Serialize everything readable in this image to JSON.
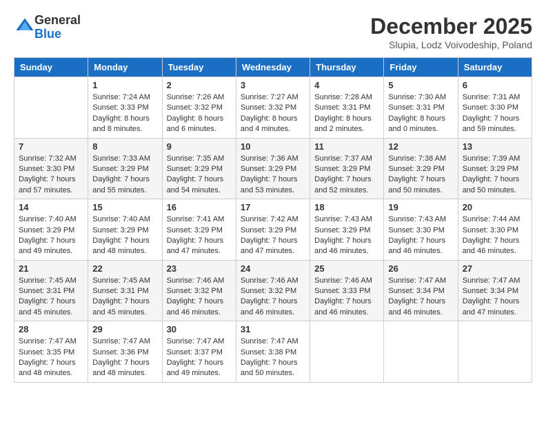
{
  "header": {
    "logo_general": "General",
    "logo_blue": "Blue",
    "month_title": "December 2025",
    "location": "Slupia, Lodz Voivodeship, Poland"
  },
  "weekdays": [
    "Sunday",
    "Monday",
    "Tuesday",
    "Wednesday",
    "Thursday",
    "Friday",
    "Saturday"
  ],
  "weeks": [
    [
      {
        "day": "",
        "sunrise": "",
        "sunset": "",
        "daylight": ""
      },
      {
        "day": "1",
        "sunrise": "Sunrise: 7:24 AM",
        "sunset": "Sunset: 3:33 PM",
        "daylight": "Daylight: 8 hours and 8 minutes."
      },
      {
        "day": "2",
        "sunrise": "Sunrise: 7:26 AM",
        "sunset": "Sunset: 3:32 PM",
        "daylight": "Daylight: 8 hours and 6 minutes."
      },
      {
        "day": "3",
        "sunrise": "Sunrise: 7:27 AM",
        "sunset": "Sunset: 3:32 PM",
        "daylight": "Daylight: 8 hours and 4 minutes."
      },
      {
        "day": "4",
        "sunrise": "Sunrise: 7:28 AM",
        "sunset": "Sunset: 3:31 PM",
        "daylight": "Daylight: 8 hours and 2 minutes."
      },
      {
        "day": "5",
        "sunrise": "Sunrise: 7:30 AM",
        "sunset": "Sunset: 3:31 PM",
        "daylight": "Daylight: 8 hours and 0 minutes."
      },
      {
        "day": "6",
        "sunrise": "Sunrise: 7:31 AM",
        "sunset": "Sunset: 3:30 PM",
        "daylight": "Daylight: 7 hours and 59 minutes."
      }
    ],
    [
      {
        "day": "7",
        "sunrise": "Sunrise: 7:32 AM",
        "sunset": "Sunset: 3:30 PM",
        "daylight": "Daylight: 7 hours and 57 minutes."
      },
      {
        "day": "8",
        "sunrise": "Sunrise: 7:33 AM",
        "sunset": "Sunset: 3:29 PM",
        "daylight": "Daylight: 7 hours and 55 minutes."
      },
      {
        "day": "9",
        "sunrise": "Sunrise: 7:35 AM",
        "sunset": "Sunset: 3:29 PM",
        "daylight": "Daylight: 7 hours and 54 minutes."
      },
      {
        "day": "10",
        "sunrise": "Sunrise: 7:36 AM",
        "sunset": "Sunset: 3:29 PM",
        "daylight": "Daylight: 7 hours and 53 minutes."
      },
      {
        "day": "11",
        "sunrise": "Sunrise: 7:37 AM",
        "sunset": "Sunset: 3:29 PM",
        "daylight": "Daylight: 7 hours and 52 minutes."
      },
      {
        "day": "12",
        "sunrise": "Sunrise: 7:38 AM",
        "sunset": "Sunset: 3:29 PM",
        "daylight": "Daylight: 7 hours and 50 minutes."
      },
      {
        "day": "13",
        "sunrise": "Sunrise: 7:39 AM",
        "sunset": "Sunset: 3:29 PM",
        "daylight": "Daylight: 7 hours and 50 minutes."
      }
    ],
    [
      {
        "day": "14",
        "sunrise": "Sunrise: 7:40 AM",
        "sunset": "Sunset: 3:29 PM",
        "daylight": "Daylight: 7 hours and 49 minutes."
      },
      {
        "day": "15",
        "sunrise": "Sunrise: 7:40 AM",
        "sunset": "Sunset: 3:29 PM",
        "daylight": "Daylight: 7 hours and 48 minutes."
      },
      {
        "day": "16",
        "sunrise": "Sunrise: 7:41 AM",
        "sunset": "Sunset: 3:29 PM",
        "daylight": "Daylight: 7 hours and 47 minutes."
      },
      {
        "day": "17",
        "sunrise": "Sunrise: 7:42 AM",
        "sunset": "Sunset: 3:29 PM",
        "daylight": "Daylight: 7 hours and 47 minutes."
      },
      {
        "day": "18",
        "sunrise": "Sunrise: 7:43 AM",
        "sunset": "Sunset: 3:29 PM",
        "daylight": "Daylight: 7 hours and 46 minutes."
      },
      {
        "day": "19",
        "sunrise": "Sunrise: 7:43 AM",
        "sunset": "Sunset: 3:30 PM",
        "daylight": "Daylight: 7 hours and 46 minutes."
      },
      {
        "day": "20",
        "sunrise": "Sunrise: 7:44 AM",
        "sunset": "Sunset: 3:30 PM",
        "daylight": "Daylight: 7 hours and 46 minutes."
      }
    ],
    [
      {
        "day": "21",
        "sunrise": "Sunrise: 7:45 AM",
        "sunset": "Sunset: 3:31 PM",
        "daylight": "Daylight: 7 hours and 45 minutes."
      },
      {
        "day": "22",
        "sunrise": "Sunrise: 7:45 AM",
        "sunset": "Sunset: 3:31 PM",
        "daylight": "Daylight: 7 hours and 45 minutes."
      },
      {
        "day": "23",
        "sunrise": "Sunrise: 7:46 AM",
        "sunset": "Sunset: 3:32 PM",
        "daylight": "Daylight: 7 hours and 46 minutes."
      },
      {
        "day": "24",
        "sunrise": "Sunrise: 7:46 AM",
        "sunset": "Sunset: 3:32 PM",
        "daylight": "Daylight: 7 hours and 46 minutes."
      },
      {
        "day": "25",
        "sunrise": "Sunrise: 7:46 AM",
        "sunset": "Sunset: 3:33 PM",
        "daylight": "Daylight: 7 hours and 46 minutes."
      },
      {
        "day": "26",
        "sunrise": "Sunrise: 7:47 AM",
        "sunset": "Sunset: 3:34 PM",
        "daylight": "Daylight: 7 hours and 46 minutes."
      },
      {
        "day": "27",
        "sunrise": "Sunrise: 7:47 AM",
        "sunset": "Sunset: 3:34 PM",
        "daylight": "Daylight: 7 hours and 47 minutes."
      }
    ],
    [
      {
        "day": "28",
        "sunrise": "Sunrise: 7:47 AM",
        "sunset": "Sunset: 3:35 PM",
        "daylight": "Daylight: 7 hours and 48 minutes."
      },
      {
        "day": "29",
        "sunrise": "Sunrise: 7:47 AM",
        "sunset": "Sunset: 3:36 PM",
        "daylight": "Daylight: 7 hours and 48 minutes."
      },
      {
        "day": "30",
        "sunrise": "Sunrise: 7:47 AM",
        "sunset": "Sunset: 3:37 PM",
        "daylight": "Daylight: 7 hours and 49 minutes."
      },
      {
        "day": "31",
        "sunrise": "Sunrise: 7:47 AM",
        "sunset": "Sunset: 3:38 PM",
        "daylight": "Daylight: 7 hours and 50 minutes."
      },
      {
        "day": "",
        "sunrise": "",
        "sunset": "",
        "daylight": ""
      },
      {
        "day": "",
        "sunrise": "",
        "sunset": "",
        "daylight": ""
      },
      {
        "day": "",
        "sunrise": "",
        "sunset": "",
        "daylight": ""
      }
    ]
  ]
}
